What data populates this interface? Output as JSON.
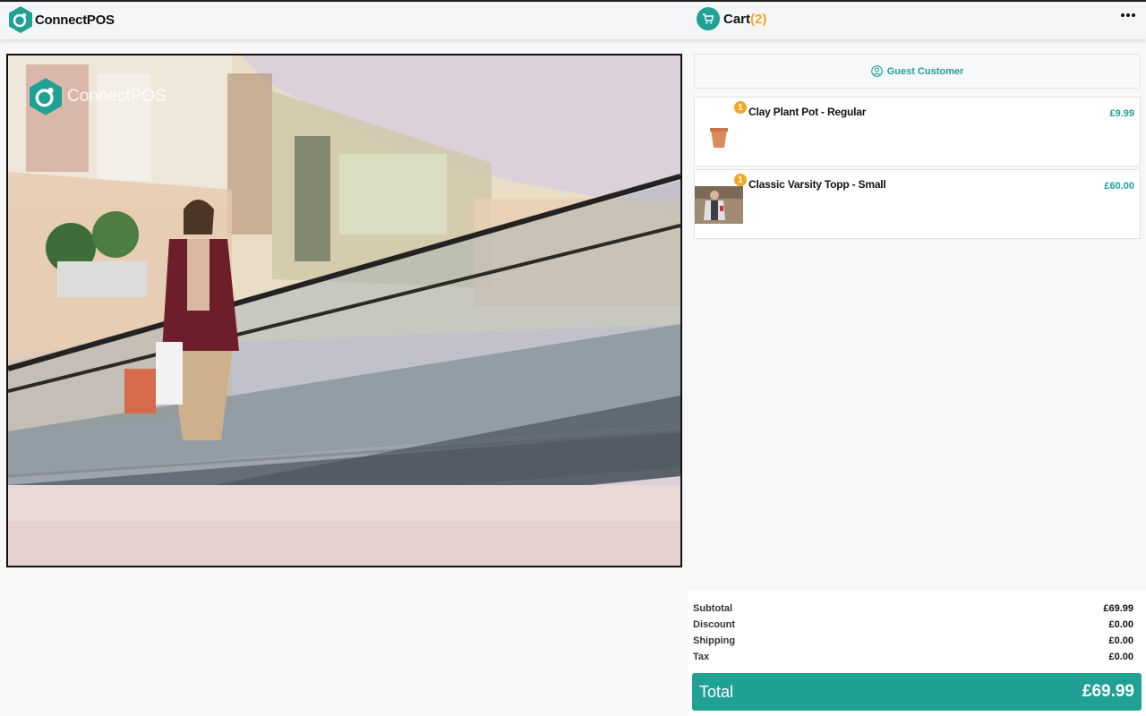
{
  "app": {
    "name": "ConnectPOS",
    "logo_icon": "connectpos-hex-logo"
  },
  "header": {
    "cart_label": "Cart",
    "cart_count": "(2)",
    "cart_icon": "cart-icon",
    "more_icon": "more-horizontal-icon"
  },
  "hero": {
    "watermark": "ConnectPOS",
    "image": "woman-on-mall-escalator-photo"
  },
  "customer": {
    "label": "Guest Customer",
    "icon": "user-circle-icon"
  },
  "cart_items": [
    {
      "name": "Clay Plant Pot - Regular",
      "price": "£9.99",
      "qty": "1",
      "thumb": "plant-pot-thumbnail"
    },
    {
      "name": "Classic Varsity Topp - Small",
      "price": "£60.00",
      "qty": "1",
      "thumb": "varsity-jacket-thumbnail"
    }
  ],
  "totals": {
    "subtotal_label": "Subtotal",
    "subtotal": "£69.99",
    "discount_label": "Discount",
    "discount": "£0.00",
    "shipping_label": "Shipping",
    "shipping": "£0.00",
    "tax_label": "Tax",
    "tax": "£0.00",
    "total_label": "Total",
    "total": "£69.99"
  },
  "colors": {
    "accent": "#21a094",
    "badge": "#f5a623"
  }
}
